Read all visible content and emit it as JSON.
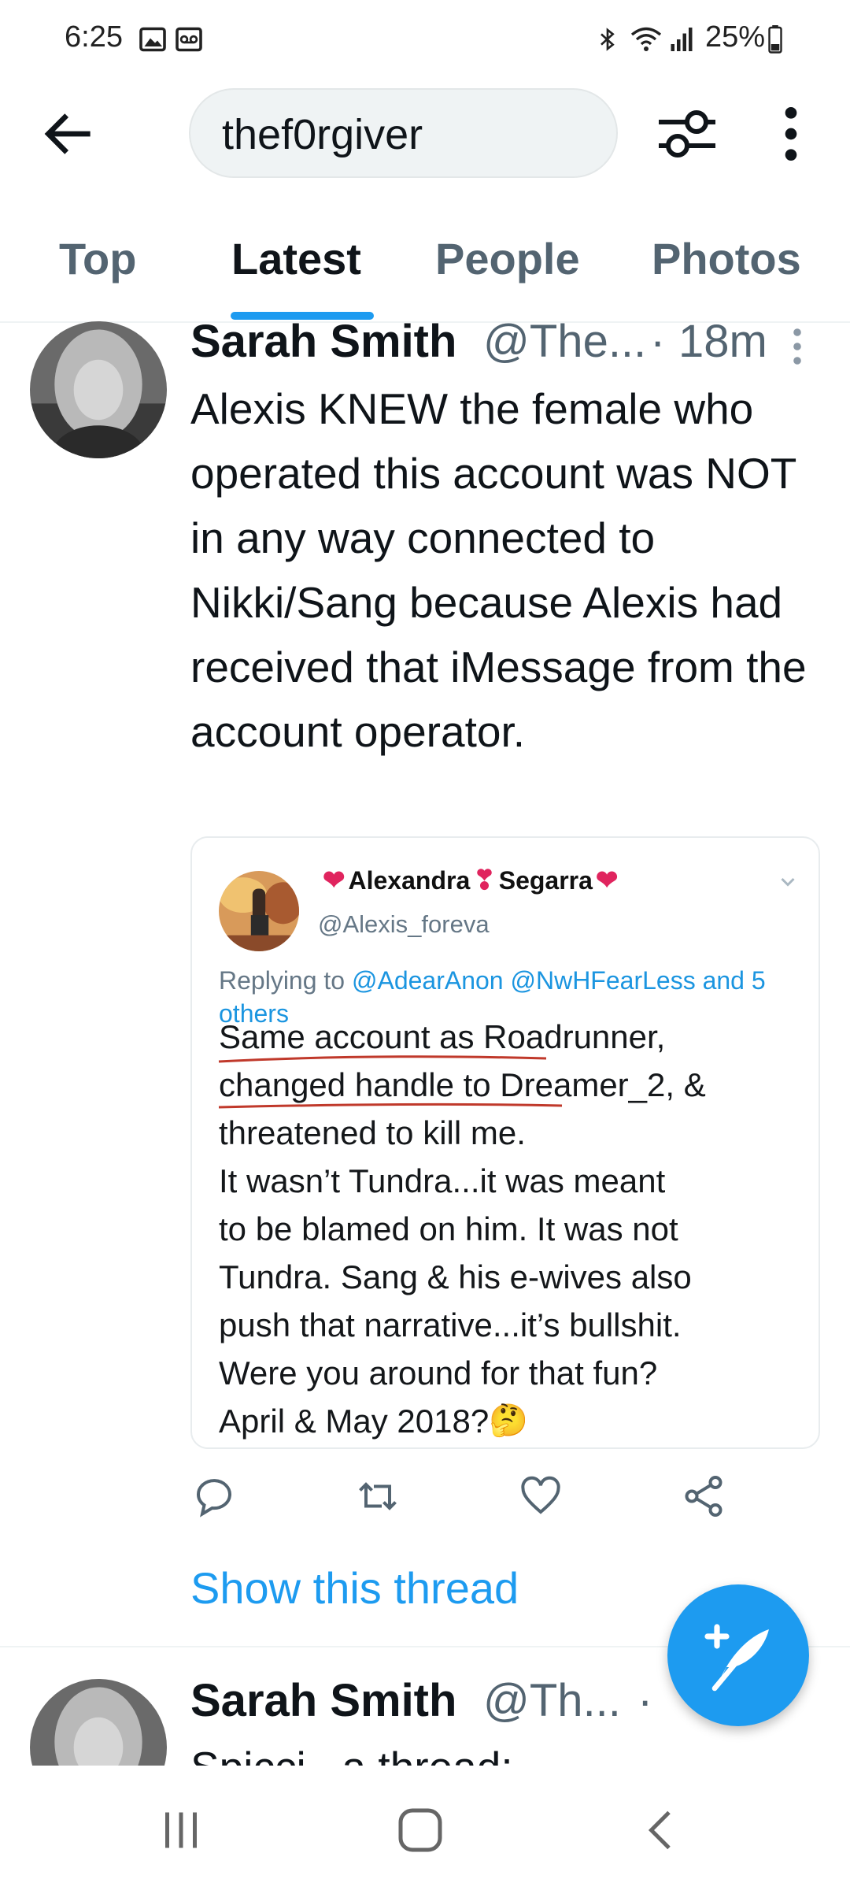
{
  "status_bar": {
    "time": "6:25",
    "battery": "25%",
    "icons": [
      "image-icon",
      "voicemail-icon",
      "bluetooth-icon",
      "wifi-icon",
      "signal-icon",
      "battery-icon"
    ]
  },
  "header": {
    "search_query": "thef0rgiver",
    "icons": [
      "back-arrow-icon",
      "filter-icon",
      "more-vertical-icon"
    ]
  },
  "tabs": [
    {
      "label": "Top"
    },
    {
      "label": "Latest",
      "active": true
    },
    {
      "label": "People"
    },
    {
      "label": "Photos"
    }
  ],
  "tweet": {
    "author_name": "Sarah Smith",
    "author_handle": "@The...",
    "separator": "·",
    "time": "18m",
    "text": "Alexis KNEW the female who operated this account was NOT in any way connected to Nikki/Sang because Alexis had received that iMessage from the account operator.",
    "quoted": {
      "name_parts": [
        "Alexandra",
        "Segarra"
      ],
      "handle": "@Alexis_foreva",
      "replying_prefix": "Replying to ",
      "replying_to": "@AdearAnon @NwHFearLess and 5 others",
      "body_lines": [
        "Same account as Roadrunner,",
        "changed handle to Dreamer_2, &",
        "threatened to kill me.",
        "It wasn’t Tundra...it was meant",
        "to be blamed on him. It was not",
        "Tundra. Sang & his e-wives also",
        "push that narrative...it’s bullshit.",
        "Were you around for that fun?",
        "April & May 2018?"
      ],
      "emoji": "🤔"
    },
    "show_thread": "Show this thread"
  },
  "next_tweet": {
    "author_name": "Sarah Smith",
    "author_handle": "@Th...",
    "separator": "·",
    "text_partial": "Spicci...a thread:"
  },
  "colors": {
    "accent": "#1d9bf0",
    "text": "#0f1419",
    "secondary": "#536471",
    "heart_red": "#e0245e"
  }
}
